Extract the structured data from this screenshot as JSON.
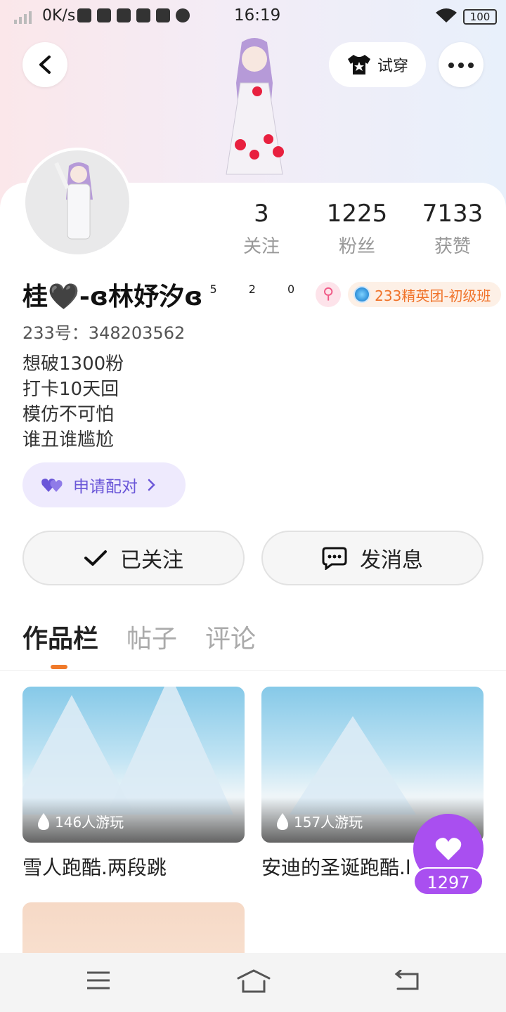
{
  "status_bar": {
    "speed": "0K/s",
    "time": "16:19",
    "battery": "100"
  },
  "header": {
    "try_on_label": "试穿"
  },
  "stats": [
    {
      "value": "3",
      "label": "关注"
    },
    {
      "value": "1225",
      "label": "粉丝"
    },
    {
      "value": "7133",
      "label": "获赞"
    }
  ],
  "profile": {
    "name": "桂🖤-ɞ林妤汐ɞ",
    "name_suffix": "5 2 0",
    "gender_symbol": "⚲",
    "badge": "233精英团-初级班",
    "uid": "233号：348203562",
    "bio": [
      "想破1300粉",
      "打卡10天回",
      "模仿不可怕",
      "谁丑谁尴尬"
    ],
    "pair_label": "申请配对"
  },
  "actions": {
    "follow_label": "已关注",
    "message_label": "发消息"
  },
  "tabs": [
    "作品栏",
    "帖子",
    "评论"
  ],
  "works": [
    {
      "plays": "146人游玩",
      "title": "雪人跑酷.两段跳"
    },
    {
      "plays": "157人游玩",
      "title": "安迪的圣诞跑酷.l"
    }
  ],
  "like": {
    "count": "1297"
  },
  "colors": {
    "accent_orange": "#f07a2a",
    "like_purple": "#a94ff0",
    "pair_purple": "#6a56d8"
  }
}
